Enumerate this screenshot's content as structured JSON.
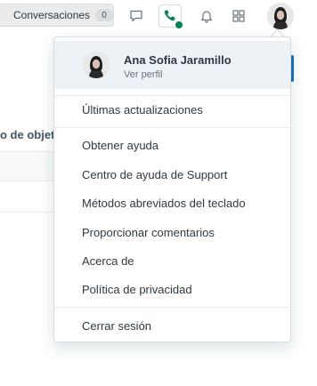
{
  "topbar": {
    "conversations_label": "Conversaciones",
    "conversations_count": "0",
    "icons": [
      "chat-icon",
      "phone-icon",
      "bell-icon",
      "apps-grid-icon"
    ],
    "status_color": "#038153"
  },
  "background": {
    "partial_text": "o de objetiv"
  },
  "menu": {
    "profile": {
      "name": "Ana Sofia Jaramillo",
      "subtitle": "Ver perfil"
    },
    "updates": "Últimas actualizaciones",
    "help_items": [
      "Obtener ayuda",
      "Centro de ayuda de Support",
      "Métodos abreviados del teclado",
      "Proporcionar comentarios",
      "Acerca de",
      "Política de privacidad"
    ],
    "sign_out": "Cerrar sesión"
  }
}
